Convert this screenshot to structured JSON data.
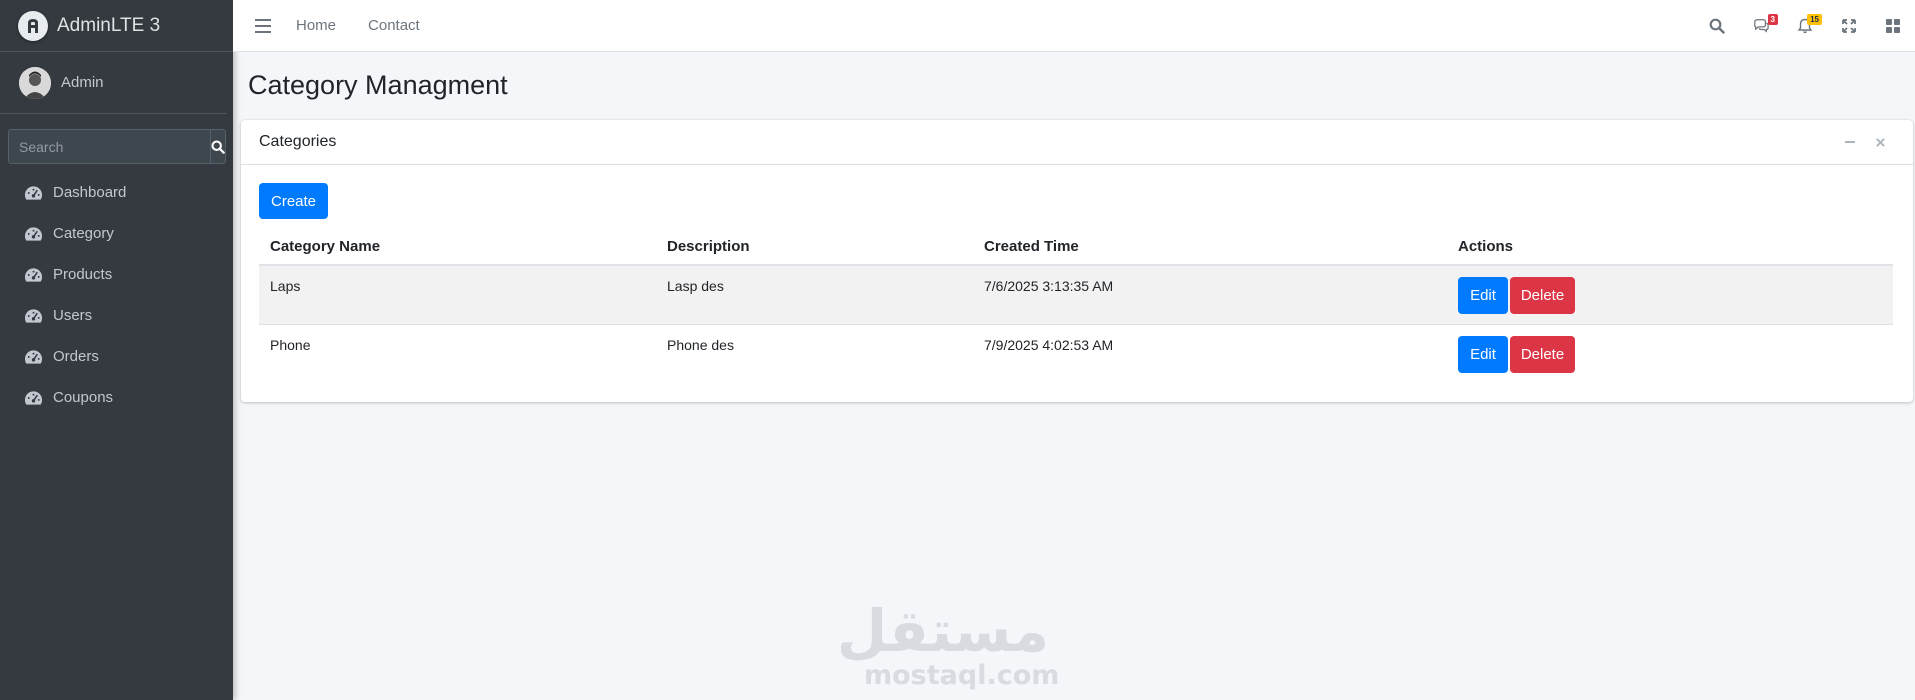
{
  "brand": {
    "name": "AdminLTE 3"
  },
  "user": {
    "name": "Admin"
  },
  "sidebar": {
    "search_placeholder": "Search",
    "items": [
      {
        "label": "Dashboard"
      },
      {
        "label": "Category"
      },
      {
        "label": "Products"
      },
      {
        "label": "Users"
      },
      {
        "label": "Orders"
      },
      {
        "label": "Coupons"
      }
    ]
  },
  "navbar": {
    "links": [
      {
        "label": "Home"
      },
      {
        "label": "Contact"
      }
    ],
    "messages_badge": "3",
    "notifications_badge": "15"
  },
  "page": {
    "title": "Category Managment"
  },
  "card": {
    "title": "Categories",
    "create_label": "Create",
    "columns": [
      "Category Name",
      "Description",
      "Created Time",
      "Actions"
    ],
    "rows": [
      {
        "name": "Laps",
        "description": "Lasp des",
        "created": "7/6/2025 3:13:35 AM",
        "edit": "Edit",
        "delete": "Delete"
      },
      {
        "name": "Phone",
        "description": "Phone des",
        "created": "7/9/2025 4:02:53 AM",
        "edit": "Edit",
        "delete": "Delete"
      }
    ]
  },
  "watermark": {
    "arabic": "مستقل",
    "latin": "mostaql.com"
  },
  "colors": {
    "sidebar": "#343a40",
    "primary": "#007bff",
    "danger": "#dc3545",
    "warning": "#ffc107",
    "background": "#f4f6f9"
  }
}
